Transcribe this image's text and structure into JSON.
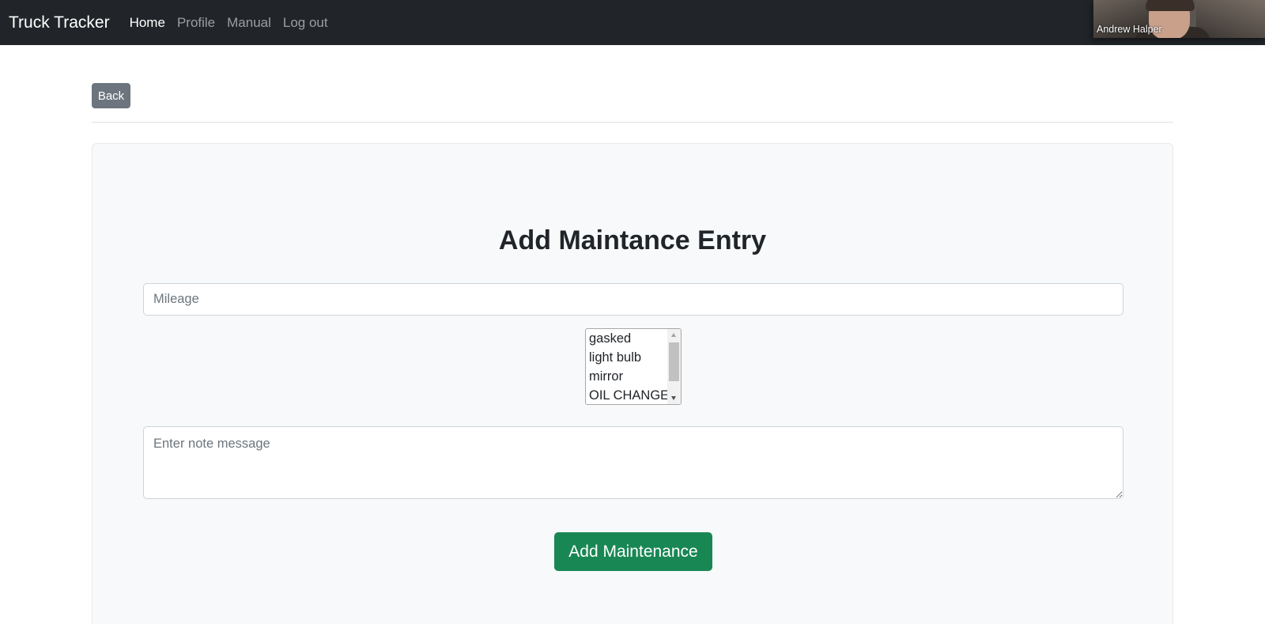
{
  "navbar": {
    "brand": "Truck Tracker",
    "links": [
      {
        "label": "Home",
        "active": true
      },
      {
        "label": "Profile",
        "active": false
      },
      {
        "label": "Manual",
        "active": false
      },
      {
        "label": "Log out",
        "active": false
      }
    ]
  },
  "video_overlay": {
    "participant_name": "Andrew Halper"
  },
  "toolbar": {
    "back_label": "Back"
  },
  "form": {
    "title": "Add Maintance Entry",
    "mileage": {
      "placeholder": "Mileage",
      "value": ""
    },
    "maintenance_types": {
      "visible_options": [
        "gasked",
        "light bulb",
        "mirror",
        "OIL CHANGE"
      ]
    },
    "note": {
      "placeholder": "Enter note message",
      "value": ""
    },
    "submit_label": "Add Maintenance"
  },
  "colors": {
    "navbar_bg": "#212529",
    "card_bg": "#f8f9fa",
    "back_button": "#6c757d",
    "submit_button": "#198754"
  }
}
